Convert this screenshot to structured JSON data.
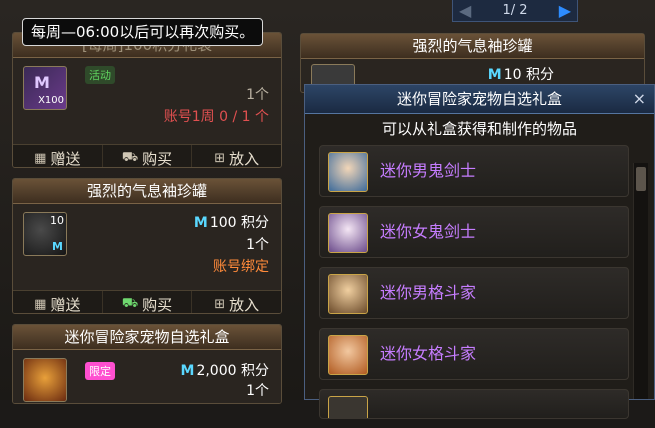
{
  "tooltip": "每周—06:00以后可以再次购买。",
  "pager": {
    "text": "1/ 2"
  },
  "card1": {
    "title": "[每周]100积分礼袋",
    "icon_count": "X100",
    "tag": "活动",
    "qty": "1个",
    "note": "账号1周 0 / 1 个",
    "buttons": [
      "赠送",
      "购买",
      "放入"
    ]
  },
  "card2": {
    "title": "强烈的气息袖珍罐",
    "icon_count": "10",
    "icon_m": "M",
    "price_value": "100",
    "price_unit": "积分",
    "qty": "1个",
    "note": "账号绑定",
    "buttons": [
      "赠送",
      "购买",
      "放入"
    ]
  },
  "card3": {
    "title": "迷你冒险家宠物自选礼盒",
    "tag": "限定",
    "price_value": "2,000",
    "price_unit": "积分",
    "qty": "1个"
  },
  "right_card": {
    "title": "强烈的气息袖珍罐",
    "price_value": "10",
    "price_unit": "积分"
  },
  "popup": {
    "title": "迷你冒险家宠物自选礼盒",
    "close": "×",
    "subtitle": "可以从礼盒获得和制作的物品",
    "items": [
      {
        "name": "迷你男鬼剑士"
      },
      {
        "name": "迷你女鬼剑士"
      },
      {
        "name": "迷你男格斗家"
      },
      {
        "name": "迷你女格斗家"
      }
    ]
  },
  "colors": {
    "accent_blue": "#5ad8ff",
    "item_purple": "#c67dff",
    "note_orange": "#ff8a3a",
    "note_red": "#e05050",
    "tag_green": "#5fd35f",
    "tag_pink": "#ff4fd0"
  },
  "icons": {
    "gift": "gift-icon",
    "buy": "cart-icon",
    "store": "basket-icon"
  }
}
